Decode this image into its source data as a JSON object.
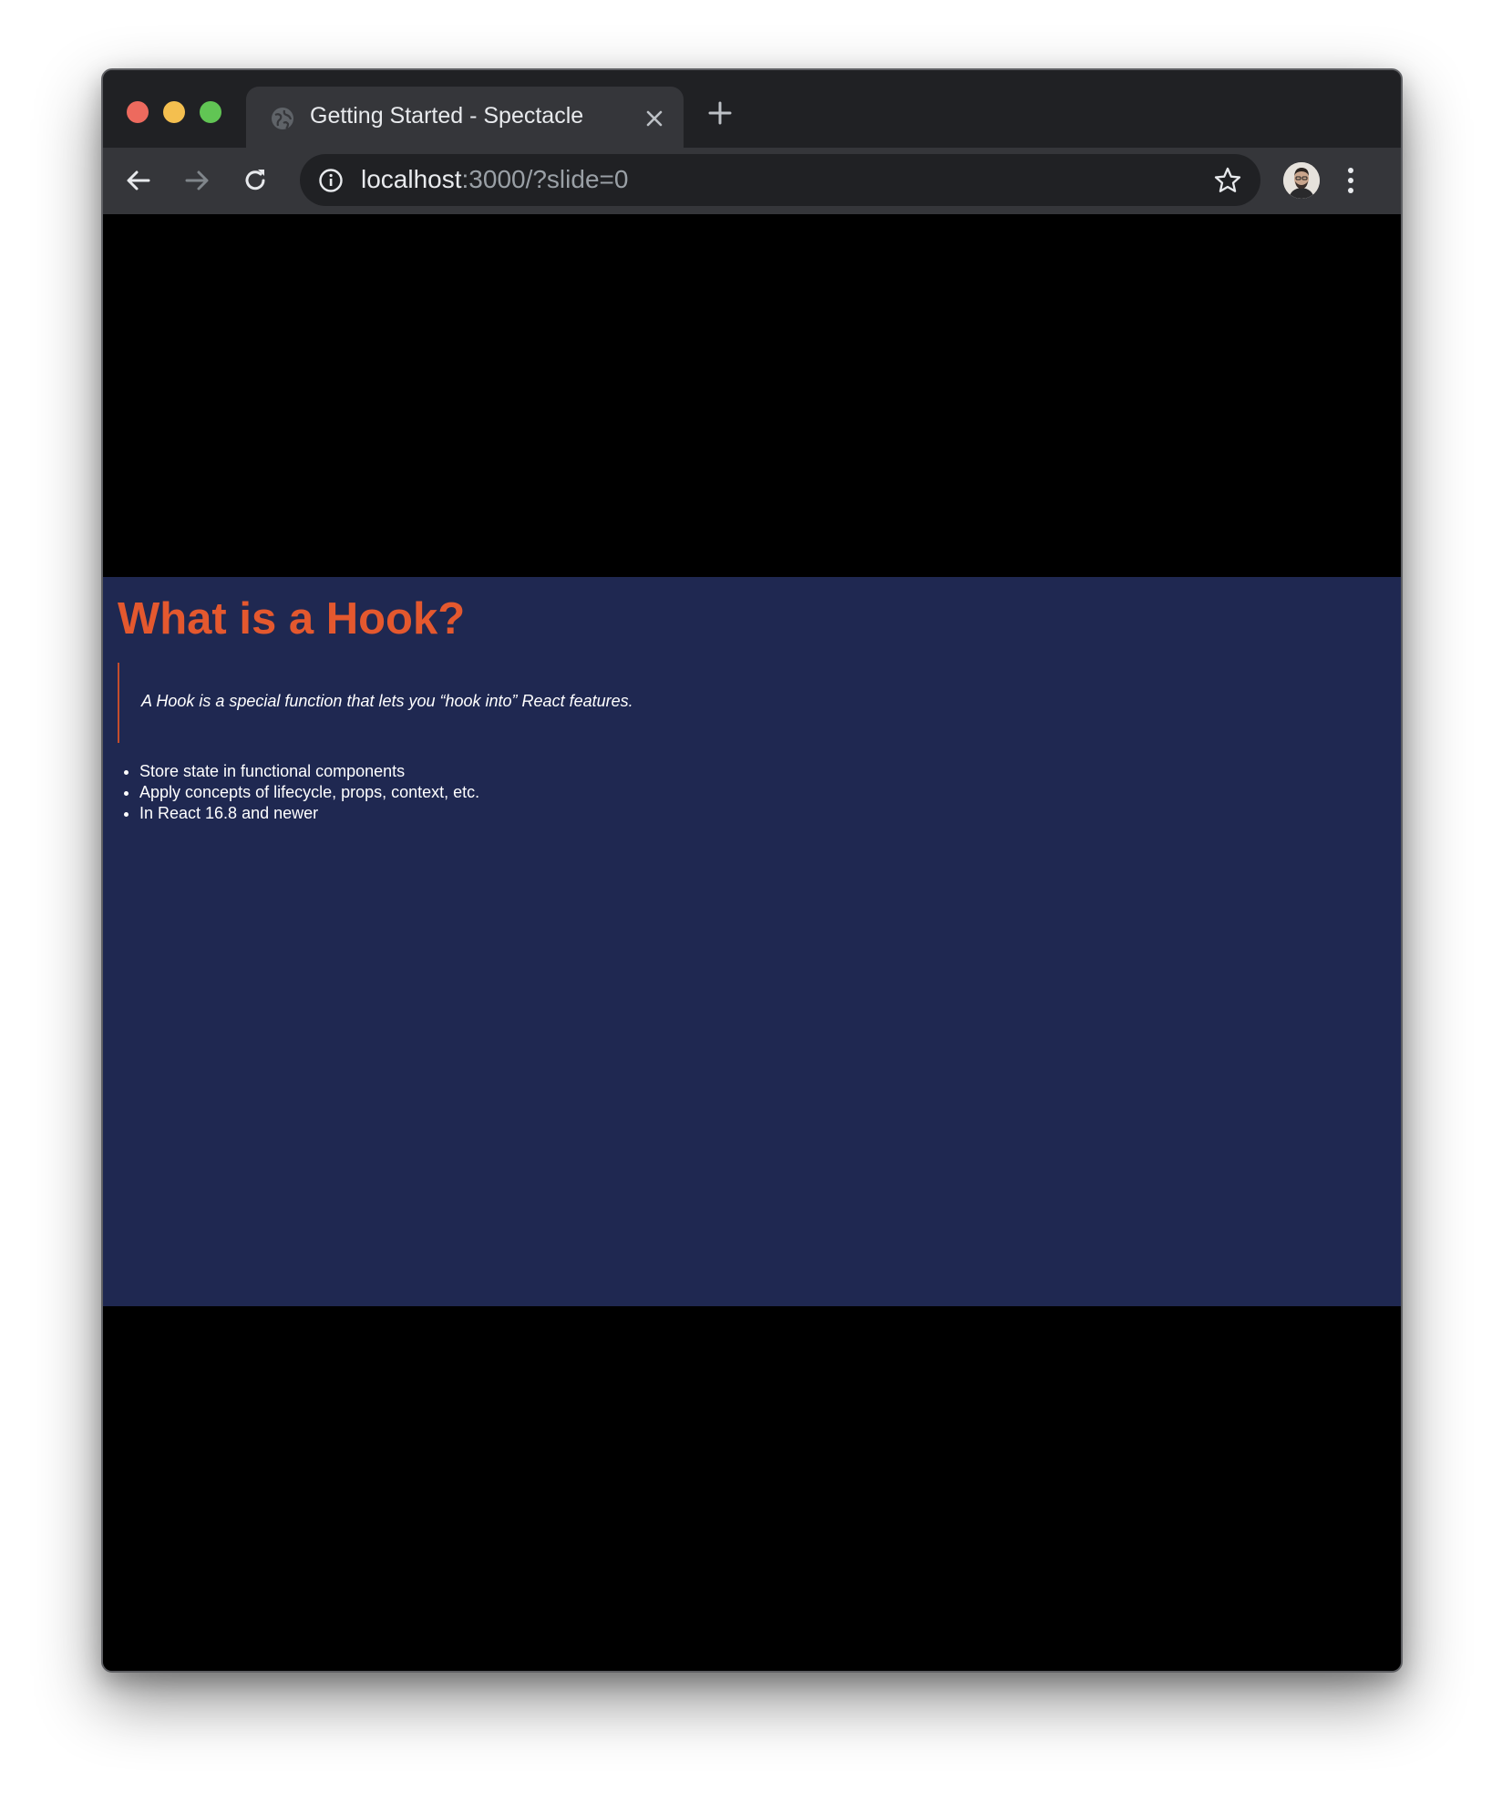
{
  "browser": {
    "tab_title": "Getting Started - Spectacle",
    "url_host": "localhost",
    "url_rest": ":3000/?slide=0"
  },
  "slide": {
    "heading": "What is a Hook?",
    "quote": "A Hook is a special function that lets you “hook into” React features.",
    "bullets": [
      "Store state in functional components",
      "Apply concepts of lifecycle, props, context, etc.",
      "In React 16.8 and newer"
    ]
  },
  "colors": {
    "slide_background": "#1f2851",
    "heading": "#e4582e",
    "quote_border": "#c44d2c",
    "letterbox": "#000000"
  },
  "icons": {
    "favicon": "globe-icon",
    "tab_close": "close-icon",
    "new_tab": "plus-icon",
    "back": "arrow-left-icon",
    "forward": "arrow-right-icon",
    "reload": "reload-icon",
    "site_info": "info-icon",
    "bookmark": "star-icon",
    "profile": "avatar",
    "menu": "kebab-menu-icon"
  }
}
